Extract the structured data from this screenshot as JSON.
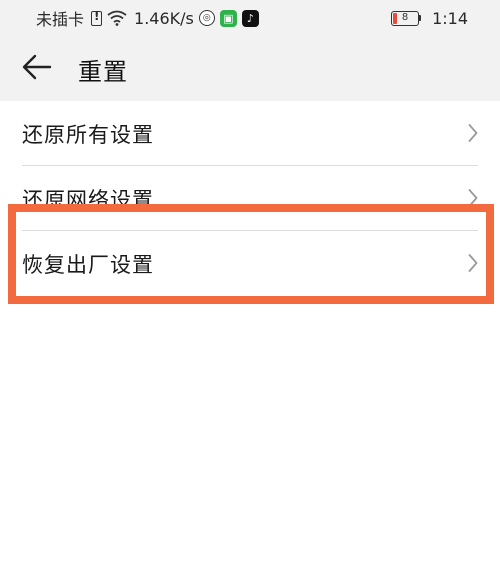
{
  "status_bar": {
    "sim_text": "未插卡",
    "speed": "1.46K/s",
    "battery_level": "8",
    "time": "1:14"
  },
  "header": {
    "title": "重置"
  },
  "list": {
    "items": [
      {
        "label": "还原所有设置"
      },
      {
        "label": "还原网络设置"
      },
      {
        "label": "恢复出厂设置"
      }
    ]
  },
  "colors": {
    "highlight": "#f26a3e",
    "header_bg": "#f2f2f2",
    "divider": "#dcdcdc"
  }
}
